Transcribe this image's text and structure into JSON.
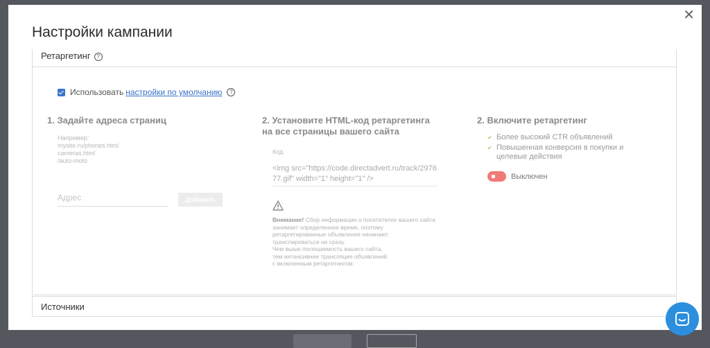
{
  "modal": {
    "title": "Настройки кампании",
    "close_icon": "close-icon"
  },
  "retargeting": {
    "header": "Ретаргетинг",
    "use_label": "Использовать",
    "use_checked": true,
    "default_settings_link": "настройки по умолчанию",
    "step1": {
      "title": "1. Задайте адреса страниц",
      "example_lines": [
        "Например:",
        "mysite.ru/phones.html",
        "cameras.html",
        "/auto-moto"
      ],
      "address_placeholder": "Адрес",
      "add_button": "Добавить"
    },
    "step2": {
      "title_line1": "2. Установите HTML-код ретаргетинга",
      "title_line2": "на все страницы вашего сайта",
      "code_label": "Код",
      "code": "<img src=\"https://code.directadvert.ru/track/297677.gif\" width=\"1\" height=\"1\" />",
      "warning_bold": "Внимание!",
      "warning_text": "Сбор информации о посетителях вашего сайта занимает определенное время, поэтому ретаргетированные объявления начинают транслироваться не сразу.",
      "warning_line2": "Чем выше посещаемость вашего сайта,",
      "warning_line3": "тем интенсивнее трансляция объявлений",
      "warning_line4": "с включенным ретаргетингом."
    },
    "step3": {
      "title": "2. Включите ретаргетинг",
      "benefits": [
        "Более высокий CTR объявлений",
        "Повышенная конверсия в покупки и целевые действия"
      ],
      "toggle_label": "Выключен",
      "toggle_on": false,
      "toggle_color": "#f07a76"
    }
  },
  "sources": {
    "header": "Источники"
  },
  "colors": {
    "accent": "#3a73c9",
    "chat_button": "#2b8fde",
    "check": "#9ccb6a"
  }
}
